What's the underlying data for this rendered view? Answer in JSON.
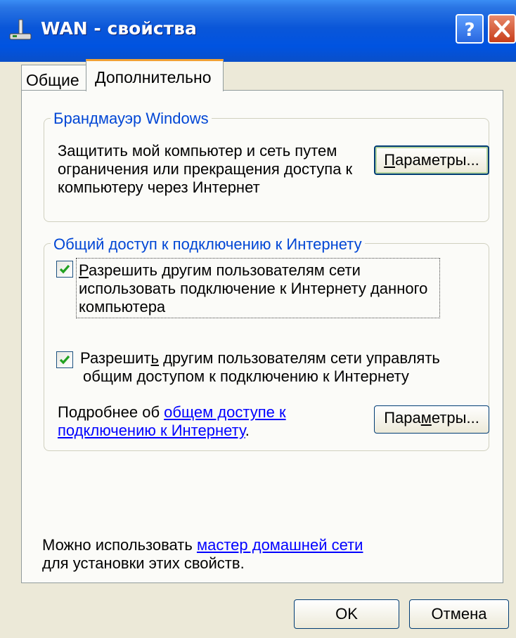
{
  "window": {
    "title": "WAN - свойства",
    "help_label": "?",
    "close_label": "X"
  },
  "tabs": [
    {
      "label": "Общие",
      "active": false
    },
    {
      "label": "Дополнительно",
      "active": true
    }
  ],
  "firewall": {
    "legend": "Брандмауэр Windows",
    "description_lines": [
      "Защитить мой компьютер и сеть путем",
      "ограничения или прекращения доступа к",
      "компьютеру через Интернет"
    ],
    "settings_button": {
      "accel": "П",
      "rest": "араметры..."
    }
  },
  "ics": {
    "legend": "Общий доступ к подключению к Интернету",
    "allow_use": {
      "checked": true,
      "label_lines": [
        {
          "accel": "Р",
          "rest": "азрешить другим пользователям сети"
        },
        "использовать подключение к Интернету данного",
        "компьютера"
      ]
    },
    "allow_control": {
      "checked": true,
      "label_lines": [
        {
          "pre": "Разрешит",
          "accel": "ь",
          "rest": " другим пользователям сети управлять"
        },
        "общим доступом к подключению к Интернету"
      ]
    },
    "more_info": {
      "prefix": "Подробнее об ",
      "link_line1": "общем доступе к",
      "link_line2": "подключению к Интернету",
      "suffix": "."
    },
    "settings_button": {
      "pre": "Пара",
      "accel": "м",
      "rest": "етры..."
    }
  },
  "footer": {
    "prefix": "Можно использовать ",
    "link": "мастер домашней сети",
    "line2": "для установки этих свойств."
  },
  "buttons": {
    "ok": "OK",
    "cancel": "Отмена"
  },
  "colors": {
    "titlebar": "#0a56d8",
    "legend_text": "#0046d5",
    "link": "#0000ff",
    "checkmark": "#21a121",
    "active_tab_accent": "#f1a136"
  },
  "icons": {
    "title": "network-connection-icon",
    "help": "help-icon",
    "close": "close-icon",
    "check": "checkmark-icon"
  }
}
